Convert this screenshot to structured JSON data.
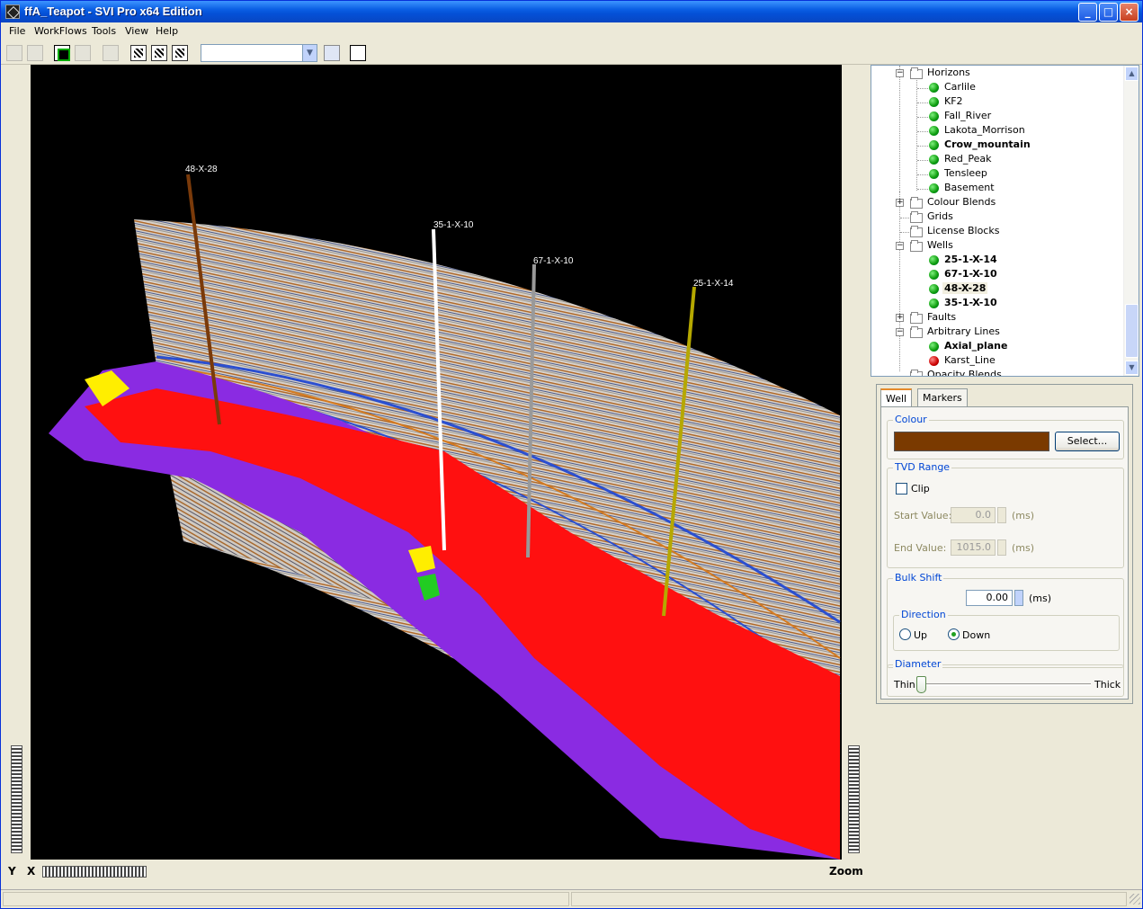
{
  "window": {
    "title": "ffA_Teapot - SVI Pro x64 Edition"
  },
  "menu": [
    "File",
    "WorkFlows",
    "Tools",
    "View",
    "Help"
  ],
  "viewport": {
    "wells": [
      {
        "name": "48-X-28",
        "color": "#7a3a0a"
      },
      {
        "name": "35-1-X-10",
        "color": "#ffffff"
      },
      {
        "name": "67-1-X-10",
        "color": "#999999"
      },
      {
        "name": "25-1-X-14",
        "color": "#b5a800"
      }
    ],
    "label_y": "Y",
    "label_x": "X",
    "label_zoom": "Zoom"
  },
  "tree": {
    "horizons": {
      "label": "Horizons",
      "items": [
        {
          "label": "Carlile",
          "bold": false,
          "status": "green"
        },
        {
          "label": "KF2",
          "bold": false,
          "status": "green"
        },
        {
          "label": "Fall_River",
          "bold": false,
          "status": "green"
        },
        {
          "label": "Lakota_Morrison",
          "bold": false,
          "status": "green"
        },
        {
          "label": "Crow_mountain",
          "bold": true,
          "status": "green"
        },
        {
          "label": "Red_Peak",
          "bold": false,
          "status": "green"
        },
        {
          "label": "Tensleep",
          "bold": false,
          "status": "green"
        },
        {
          "label": "Basement",
          "bold": false,
          "status": "green"
        }
      ]
    },
    "colour_blends": "Colour Blends",
    "grids": "Grids",
    "license_blocks": "License Blocks",
    "wells": {
      "label": "Wells",
      "items": [
        {
          "label": "25-1-X-14",
          "bold": true
        },
        {
          "label": "67-1-X-10",
          "bold": true
        },
        {
          "label": "48-X-28",
          "bold": true,
          "selected": true
        },
        {
          "label": "35-1-X-10",
          "bold": true
        }
      ]
    },
    "faults": "Faults",
    "arbitrary_lines": {
      "label": "Arbitrary Lines",
      "items": [
        {
          "label": "Axial_plane",
          "bold": true,
          "status": "green"
        },
        {
          "label": "Karst_Line",
          "bold": false,
          "status": "red"
        }
      ]
    },
    "opacity_blends": "Opacity Blends"
  },
  "panel": {
    "tabs": [
      "Well",
      "Markers"
    ],
    "colour": {
      "title": "Colour",
      "swatch": "#7a3a00",
      "select_label": "Select..."
    },
    "tvd": {
      "title": "TVD Range",
      "clip_label": "Clip",
      "start_label": "Start Value:",
      "start_value": "0.0",
      "end_label": "End Value:",
      "end_value": "1015.0",
      "unit": "(ms)"
    },
    "bulk_shift": {
      "title": "Bulk Shift",
      "value": "0.00",
      "unit": "(ms)"
    },
    "direction": {
      "title": "Direction",
      "up": "Up",
      "down": "Down",
      "selected": "Down"
    },
    "diameter": {
      "title": "Diameter",
      "thin": "Thin",
      "thick": "Thick",
      "level": 0.0
    }
  }
}
